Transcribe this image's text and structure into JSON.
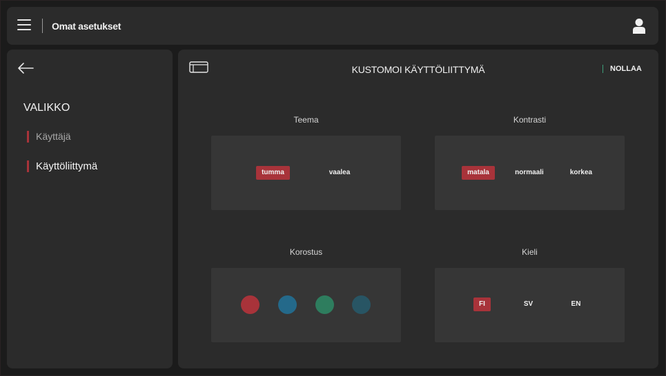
{
  "header": {
    "title": "Omat asetukset"
  },
  "sidebar": {
    "heading": "VALIKKO",
    "items": [
      {
        "label": "Käyttäjä"
      },
      {
        "label": "Käyttöliittymä"
      }
    ]
  },
  "main": {
    "title": "KUSTOMOI KÄYTTÖLIITTYMÄ",
    "reset_label": "NOLLAA",
    "theme": {
      "label": "Teema",
      "options": [
        "tumma",
        "vaalea"
      ],
      "selected": "tumma"
    },
    "contrast": {
      "label": "Kontrasti",
      "options": [
        "matala",
        "normaali",
        "korkea"
      ],
      "selected": "matala"
    },
    "accent": {
      "label": "Korostus",
      "colors": [
        "#a8333a",
        "#24698a",
        "#2e7d5e",
        "#285564"
      ]
    },
    "language": {
      "label": "Kieli",
      "options": [
        "FI",
        "SV",
        "EN"
      ],
      "selected": "FI"
    }
  },
  "colors": {
    "accent_red": "#a8333a",
    "accent_green": "#3da07a",
    "panel": "#2b2b2b",
    "card": "#363636"
  },
  "icons": {
    "menu": "hamburger-icon",
    "user": "user-icon",
    "back": "arrow-left-icon",
    "layout": "layout-icon"
  }
}
